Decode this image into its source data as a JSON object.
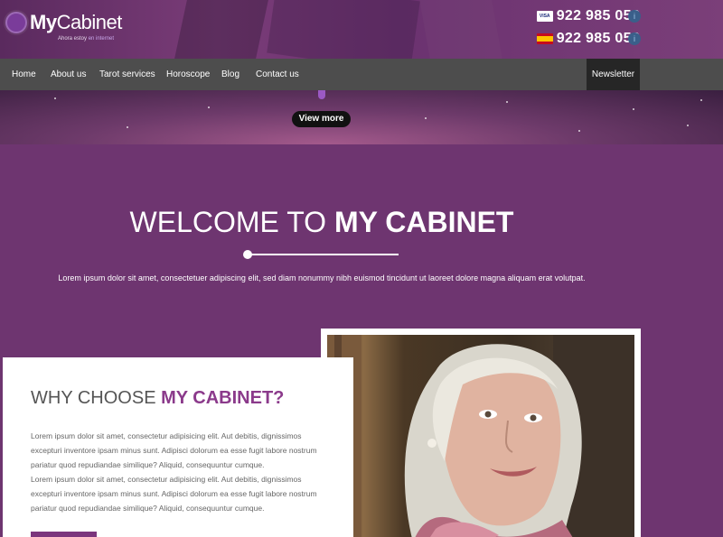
{
  "header": {
    "logo": {
      "my": "My",
      "cabinet": "Cabinet",
      "tagline_a": "Ahora estoy",
      "tagline_b": "en internet"
    },
    "phones": [
      {
        "icon": "visa-card-icon",
        "number": "922 985 058"
      },
      {
        "icon": "spain-flag-icon",
        "number": "922 985 058"
      }
    ],
    "visa_text": "VISA",
    "info_icon": "i"
  },
  "nav": {
    "items": [
      "Home",
      "About us",
      "Tarot services",
      "Horoscope",
      "Blog",
      "Contact us"
    ],
    "newsletter": "Newsletter"
  },
  "banner": {
    "view_more": "View more"
  },
  "welcome": {
    "title_light": "WELCOME TO ",
    "title_bold": "MY CABINET",
    "text": "Lorem ipsum dolor sit amet, consectetuer adipiscing elit, sed diam nonummy nibh euismod tincidunt ut laoreet dolore magna aliquam erat volutpat."
  },
  "why": {
    "title_light": "WHY CHOOSE ",
    "title_bold": "MY CABINET?",
    "p1": "Lorem ipsum dolor sit amet, consectetur adipisicing elit. Aut debitis, dignissimos excepturi inventore ipsam minus sunt. Adipisci dolorum ea esse fugit labore nostrum pariatur quod repudiandae similique? Aliquid, consequuntur cumque.",
    "p2": "Lorem ipsum dolor sit amet, consectetur adipisicing elit. Aut debitis, dignissimos excepturi inventore ipsam minus sunt. Adipisci dolorum ea esse fugit labore nostrum pariatur quod repudiandae similique? Aliquid, consequuntur cumque."
  },
  "colors": {
    "brand_purple": "#6e3570",
    "nav_gray": "#4d4d4d",
    "accent": "#8b3a8b"
  }
}
